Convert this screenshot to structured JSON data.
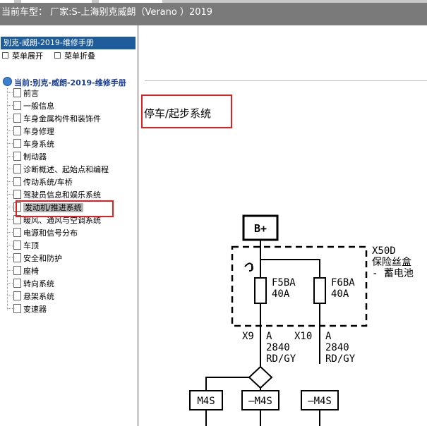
{
  "window": {
    "title": "当前车型： 厂家:S-上海别克威朗（Verano ）2019"
  },
  "sidebar": {
    "header": "别克-威朗-2019-维修手册",
    "expand_label": "菜单展开",
    "collapse_label": "菜单折叠",
    "tree_root": "当前:别克-威朗-2019-维修手册",
    "items": [
      {
        "label": "前言"
      },
      {
        "label": "一般信息"
      },
      {
        "label": "车身金属构件和装饰件"
      },
      {
        "label": "车身修理"
      },
      {
        "label": "车身系统"
      },
      {
        "label": "制动器"
      },
      {
        "label": "诊断概述、起始点和编程"
      },
      {
        "label": "传动系统/车桥"
      },
      {
        "label": "驾驶员信息和娱乐系统"
      },
      {
        "label": "发动机/推进系统"
      },
      {
        "label": "暖风、通风与空调系统"
      },
      {
        "label": "电源和信号分布"
      },
      {
        "label": "车顶"
      },
      {
        "label": "安全和防护"
      },
      {
        "label": "座椅"
      },
      {
        "label": "转向系统"
      },
      {
        "label": "悬架系统"
      },
      {
        "label": "变速器"
      }
    ],
    "selected_index": 9
  },
  "content": {
    "section_title": "停车/起步系统",
    "diagram": {
      "battery_label": "B+",
      "fusebox_id": "X50D",
      "fusebox_name_line1": "保险丝盒",
      "fusebox_name_line2": "- 蓄电池",
      "fuse_left_name": "F5BA",
      "fuse_left_rating": "40A",
      "fuse_right_name": "F6BA",
      "fuse_right_rating": "40A",
      "conn_left_id": "X9",
      "conn_left_pin": "A",
      "conn_right_id": "X10",
      "conn_right_pin": "A",
      "wire_left_circuit": "2840",
      "wire_left_color": "RD/GY",
      "wire_right_circuit": "2840",
      "wire_right_color": "RD/GY",
      "module_1": "M4S",
      "module_2": "–M4S",
      "module_3": "–M4S"
    }
  },
  "colors": {
    "titlebar": "#7a7a7a",
    "sidebar_header": "#1f5c9a",
    "highlight": "#e02020",
    "selected_bg": "#b6b6b6"
  }
}
